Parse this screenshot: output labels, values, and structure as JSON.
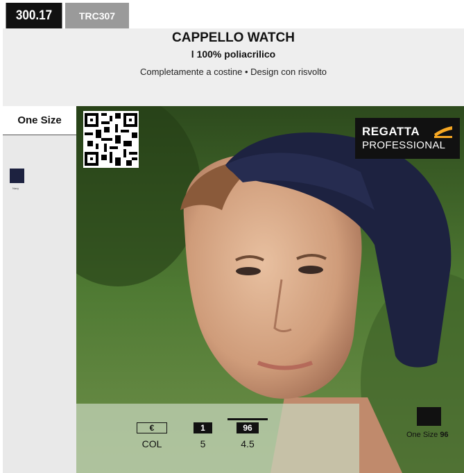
{
  "header": {
    "code": "300.17",
    "ref": "TRC307"
  },
  "product": {
    "title": "CAPPELLO WATCH",
    "material": "l 100% poliacrilico",
    "description": "Completamente a costine • Design con risvolto"
  },
  "sizes": {
    "label": "One Size"
  },
  "colours": [
    {
      "name": "Navy",
      "hex": "#1d2240"
    }
  ],
  "brand": {
    "line1": "REGATTA",
    "line2": "PROFESSIONAL",
    "accent": "#f7a823"
  },
  "info": {
    "price_icon": "€",
    "price_label": "COL",
    "qty_badge": "1",
    "qty_value": "5",
    "weight_badge": "96",
    "weight_value": "4.5"
  },
  "packing": {
    "label": "One Size",
    "count": "96"
  }
}
